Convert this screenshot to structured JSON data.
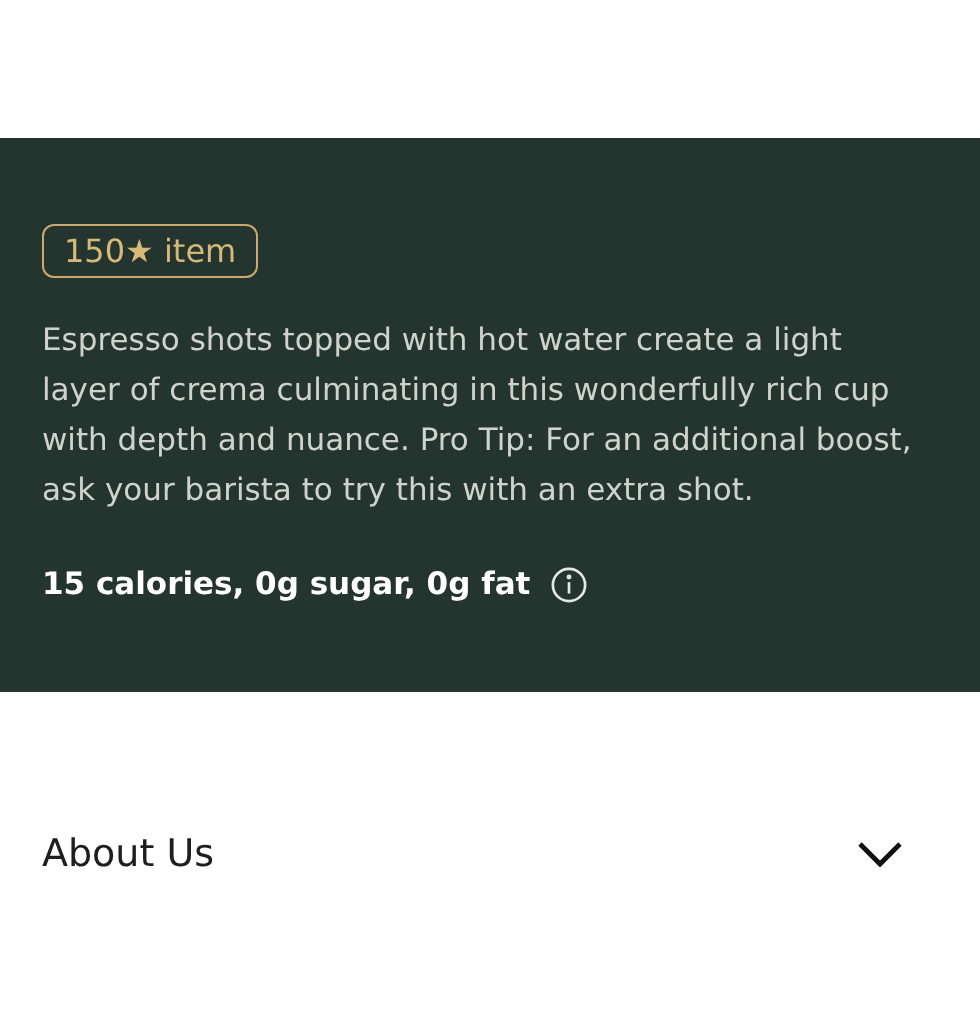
{
  "product": {
    "badge": "150★ item",
    "description": "Espresso shots topped with hot water create a light layer of crema culminating in this wonderfully rich cup with depth and nuance. Pro Tip: For an additional boost, ask your barista to try this with an extra shot.",
    "nutrition": "15 calories, 0g sugar, 0g fat"
  },
  "sections": [
    {
      "label": "About Us",
      "expanded": false
    }
  ]
}
